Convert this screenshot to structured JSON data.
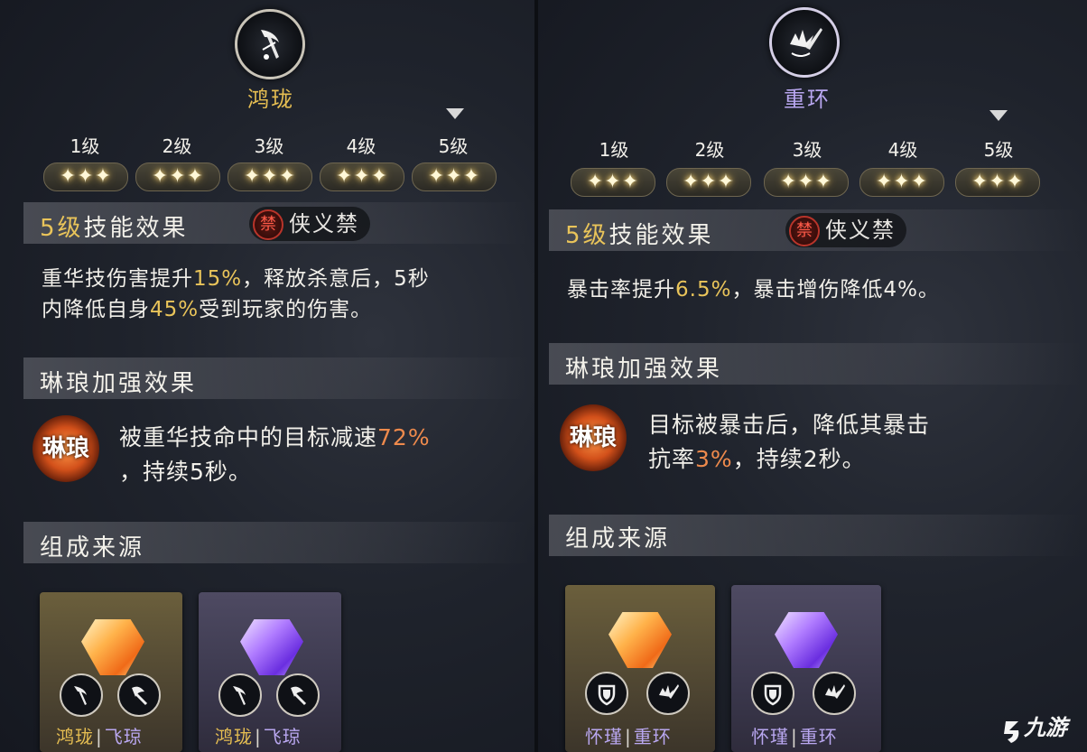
{
  "left": {
    "skill_name": "鸿珑",
    "levels": [
      "1级",
      "2级",
      "3级",
      "4级",
      "5级"
    ],
    "stars": "✦✦✦",
    "effect_header": {
      "level": "5级",
      "rest": "技能效果"
    },
    "ban_icon": "禁",
    "ban_label": "侠义禁",
    "effect_text": {
      "p1": "重华技伤害提升",
      "v1": "15%",
      "p2": "，释放杀意后，5秒",
      "p3": "内降低自身",
      "v2": "45%",
      "p4": "受到玩家的伤害。"
    },
    "enhance_header": "琳琅加强效果",
    "linlang_badge": "琳琅",
    "enhance_text": {
      "p1": "被重华技命中的目标减速",
      "v1": "72%",
      "p2": "，持续5秒。"
    },
    "source_header": "组成来源",
    "cards": [
      {
        "name_a": "鸿珑",
        "sep": "|",
        "name_b": "飞琼",
        "gem": "amber-gem-icon"
      },
      {
        "name_a": "鸿珑",
        "sep": "|",
        "name_b": "飞琼",
        "gem": "violet-gem-icon"
      }
    ]
  },
  "right": {
    "skill_name": "重环",
    "levels": [
      "1级",
      "2级",
      "3级",
      "4级",
      "5级"
    ],
    "stars": "✦✦✦",
    "effect_header": {
      "level": "5级",
      "rest": "技能效果"
    },
    "ban_icon": "禁",
    "ban_label": "侠义禁",
    "effect_text": {
      "p1": "暴击率提升",
      "v1": "6.5%",
      "p2": "，暴击增伤降低4%。"
    },
    "enhance_header": "琳琅加强效果",
    "linlang_badge": "琳琅",
    "enhance_text": {
      "p1": "目标被暴击后，降低其暴击",
      "p2": "抗率",
      "v1": "3%",
      "p3": "，持续2秒。"
    },
    "source_header": "组成来源",
    "cards": [
      {
        "name_a": "怀瑾",
        "sep": "|",
        "name_b": "重环",
        "gem": "amber-gem-icon"
      },
      {
        "name_a": "怀瑾",
        "sep": "|",
        "name_b": "重环",
        "gem": "violet-gem-icon"
      }
    ]
  },
  "watermark": "九游",
  "colors": {
    "gold": "#e9c45a",
    "orange": "#ee8a4c",
    "violet_title": "#b9a7f0",
    "gold_title": "#e6be52"
  }
}
